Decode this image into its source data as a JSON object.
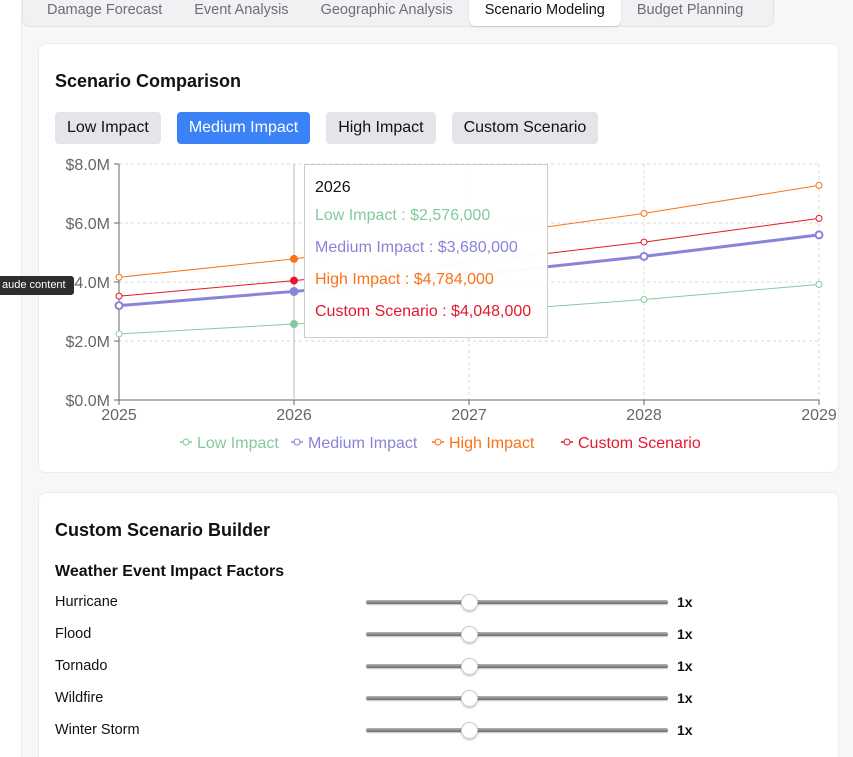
{
  "tabs": [
    {
      "label": "Damage Forecast",
      "active": false
    },
    {
      "label": "Event Analysis",
      "active": false
    },
    {
      "label": "Geographic Analysis",
      "active": false
    },
    {
      "label": "Scenario Modeling",
      "active": true
    },
    {
      "label": "Budget Planning",
      "active": false
    }
  ],
  "side_badge": "aude content",
  "scenario_comparison": {
    "title": "Scenario Comparison",
    "buttons": [
      {
        "label": "Low Impact",
        "active": false
      },
      {
        "label": "Medium Impact",
        "active": true
      },
      {
        "label": "High Impact",
        "active": false
      },
      {
        "label": "Custom Scenario",
        "active": false
      }
    ],
    "tooltip": {
      "title": "2026",
      "rows": [
        {
          "text": "Low Impact : $2,576,000",
          "color": "#82ca9d"
        },
        {
          "text": "Medium Impact : $3,680,000",
          "color": "#8884d8"
        },
        {
          "text": "High Impact : $4,784,000",
          "color": "#f97316"
        },
        {
          "text": "Custom Scenario : $4,048,000",
          "color": "#e5182d"
        }
      ]
    }
  },
  "chart_data": {
    "type": "line",
    "x": [
      "2025",
      "2026",
      "2027",
      "2028",
      "2029"
    ],
    "ylim": [
      0,
      8000000
    ],
    "y_ticks": [
      "$0.0M",
      "$2.0M",
      "$4.0M",
      "$6.0M",
      "$8.0M"
    ],
    "grid": true,
    "legend_position": "bottom",
    "series": [
      {
        "name": "Low Impact",
        "color": "#82ca9d",
        "values": [
          2240000,
          2576000,
          2963000,
          3407000,
          3918000
        ]
      },
      {
        "name": "Medium Impact",
        "color": "#8884d8",
        "values": [
          3200000,
          3680000,
          4232000,
          4867000,
          5597000
        ]
      },
      {
        "name": "High Impact",
        "color": "#f97316",
        "values": [
          4160000,
          4784000,
          5502000,
          6327000,
          7276000
        ]
      },
      {
        "name": "Custom Scenario",
        "color": "#e5182d",
        "values": [
          3520000,
          4048000,
          4655000,
          5353000,
          6156000
        ]
      }
    ],
    "highlight_x": "2026"
  },
  "builder": {
    "title": "Custom Scenario Builder",
    "subtitle": "Weather Event Impact Factors",
    "factors": [
      {
        "label": "Hurricane",
        "value": "1x",
        "level": 0.34
      },
      {
        "label": "Flood",
        "value": "1x",
        "level": 0.34
      },
      {
        "label": "Tornado",
        "value": "1x",
        "level": 0.34
      },
      {
        "label": "Wildfire",
        "value": "1x",
        "level": 0.34
      },
      {
        "label": "Winter Storm",
        "value": "1x",
        "level": 0.34
      }
    ]
  }
}
